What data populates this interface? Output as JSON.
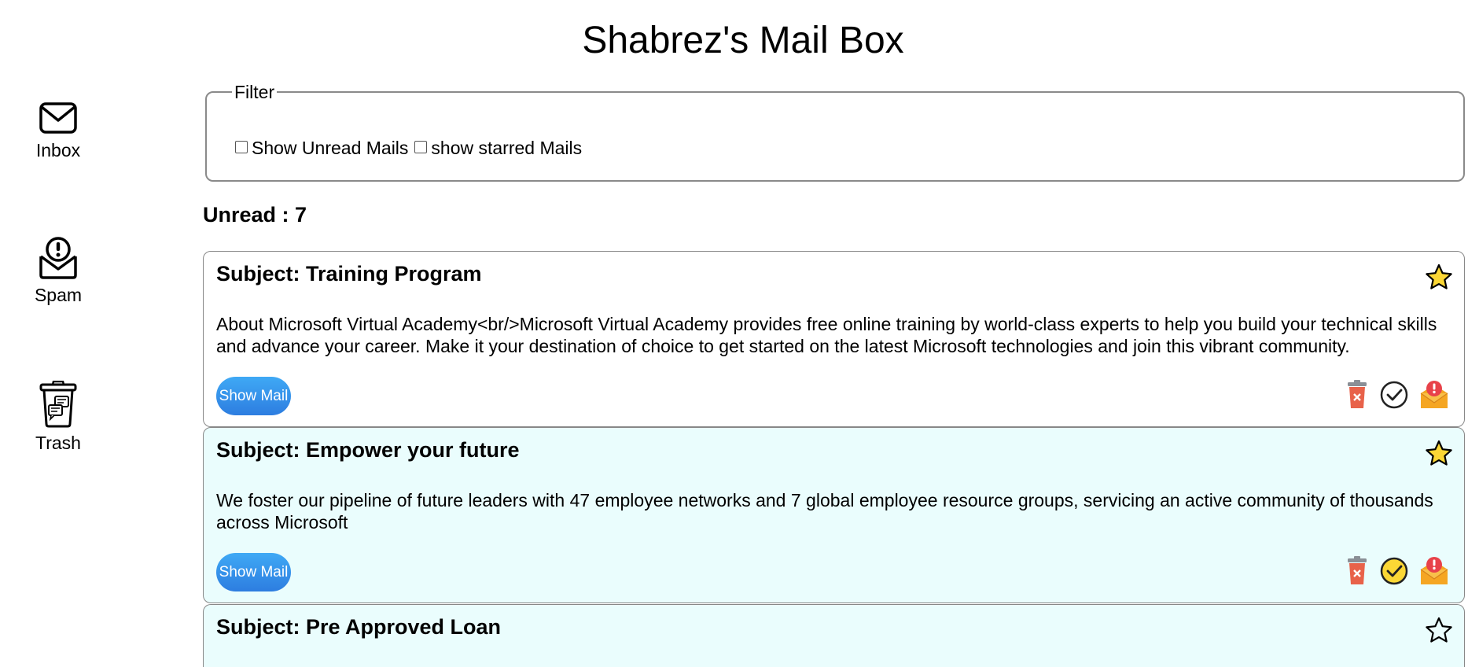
{
  "app": {
    "title": "Shabrez's Mail Box"
  },
  "nav": {
    "items": [
      {
        "label": "Inbox",
        "icon": "envelope-icon"
      },
      {
        "label": "Spam",
        "icon": "spam-envelope-icon"
      },
      {
        "label": "Trash",
        "icon": "trash-bin-icon"
      }
    ]
  },
  "filter": {
    "legend": "Filter",
    "unread_label": "Show Unread Mails",
    "unread_checked": false,
    "starred_label": "show starred Mails",
    "starred_checked": false
  },
  "unread_count_text": "Unread : 7",
  "mails": [
    {
      "subject": "Subject: Training Program",
      "body": "About Microsoft Virtual Academy<br/>Microsoft Virtual Academy provides free online training by world-class experts to help you build your technical skills and advance your career. Make it your destination of choice to get started on the latest Microsoft technologies and join this vibrant community.",
      "button_label": "Show Mail",
      "starred": true,
      "read": true
    },
    {
      "subject": "Subject: Empower your future",
      "body": "We foster our pipeline of future leaders with 47 employee networks and 7 global employee resource groups, servicing an active community of thousands across Microsoft",
      "button_label": "Show Mail",
      "starred": true,
      "read": false
    },
    {
      "subject": "Subject: Pre Approved Loan",
      "starred": false,
      "read": false
    }
  ],
  "colors": {
    "star_fill": "#fbd735",
    "read_bg": "#ffffff",
    "unread_bg": "#eafdfd",
    "button_top": "#3fa9f5",
    "button_bottom": "#2d7de0",
    "delete_icon": "#e8624a",
    "spam_icon": "#f5a623"
  }
}
